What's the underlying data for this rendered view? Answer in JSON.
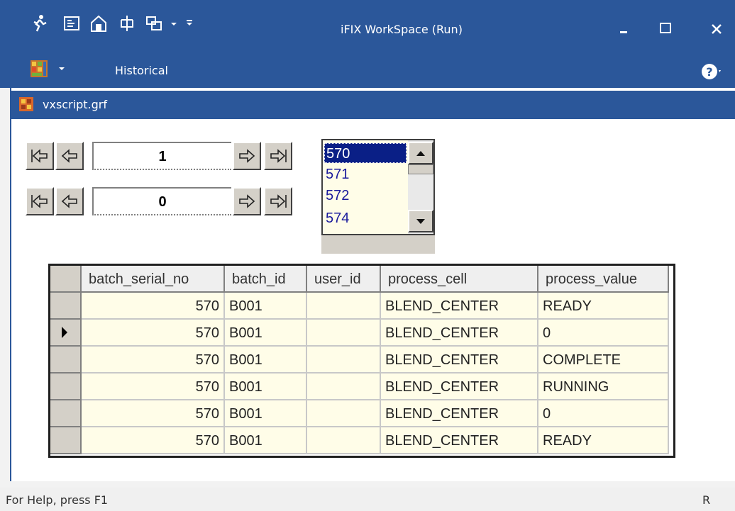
{
  "window": {
    "title": "iFIX WorkSpace (Run)"
  },
  "ribbon": {
    "tab": "Historical"
  },
  "document": {
    "title": "vxscript.grf"
  },
  "navigators": [
    {
      "value": "1"
    },
    {
      "value": "0"
    }
  ],
  "listbox": {
    "items": [
      "570",
      "571",
      "572",
      "574"
    ],
    "selected": "570"
  },
  "grid": {
    "columns": [
      "batch_serial_no",
      "batch_id",
      "user_id",
      "process_cell",
      "process_value"
    ],
    "rows": [
      [
        "570",
        "B001",
        "",
        "BLEND_CENTER",
        "READY"
      ],
      [
        "570",
        "B001",
        "",
        "BLEND_CENTER",
        "0"
      ],
      [
        "570",
        "B001",
        "",
        "BLEND_CENTER",
        "COMPLETE"
      ],
      [
        "570",
        "B001",
        "",
        "BLEND_CENTER",
        "RUNNING"
      ],
      [
        "570",
        "B001",
        "",
        "BLEND_CENTER",
        "0"
      ],
      [
        "570",
        "B001",
        "",
        "BLEND_CENTER",
        "READY"
      ]
    ],
    "current_row_index": 1
  },
  "status": {
    "help": "For Help, press F1",
    "right": "R"
  },
  "colors": {
    "accent": "#2b579a",
    "grid_fill": "#fffde8",
    "selection": "#0a1f86"
  }
}
